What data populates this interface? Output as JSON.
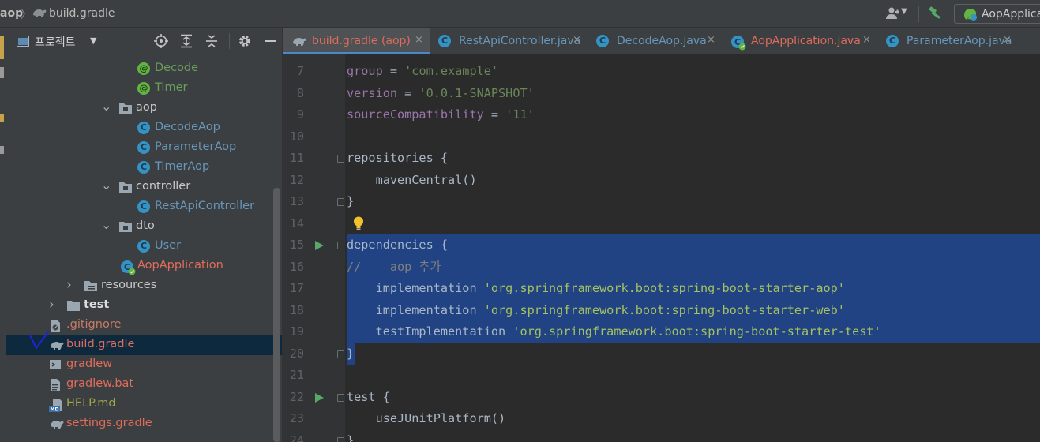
{
  "navbar": {
    "project": "aop",
    "separator": "〉",
    "file": "build.gradle",
    "run_config": "AopApplication"
  },
  "project_panel": {
    "title": "프로젝트",
    "tree": [
      {
        "label": "Decode",
        "icon": "annotation-icon",
        "color": "green",
        "indent": 166
      },
      {
        "label": "Timer",
        "icon": "annotation-icon",
        "color": "green",
        "indent": 166
      },
      {
        "label": "aop",
        "icon": "package-folder-icon",
        "color": "white",
        "indent": 142,
        "arrow": "down"
      },
      {
        "label": "DecodeAop",
        "icon": "class-icon",
        "color": "blue",
        "indent": 166
      },
      {
        "label": "ParameterAop",
        "icon": "class-icon",
        "color": "blue",
        "indent": 166
      },
      {
        "label": "TimerAop",
        "icon": "class-icon",
        "color": "blue",
        "indent": 166
      },
      {
        "label": "controller",
        "icon": "package-folder-icon",
        "color": "white",
        "indent": 142,
        "arrow": "down"
      },
      {
        "label": "RestApiController",
        "icon": "class-icon",
        "color": "blue",
        "indent": 166
      },
      {
        "label": "dto",
        "icon": "package-folder-icon",
        "color": "white",
        "indent": 142,
        "arrow": "down"
      },
      {
        "label": "User",
        "icon": "class-icon",
        "color": "blue",
        "indent": 166
      },
      {
        "label": "AopApplication",
        "icon": "spring-app-icon",
        "color": "red",
        "indent": 144
      },
      {
        "label": "resources",
        "icon": "resources-folder-icon",
        "color": "white",
        "indent": 98,
        "arrow": "right"
      },
      {
        "label": "test",
        "icon": "folder-icon",
        "color": "bold",
        "indent": 76,
        "arrow": "right"
      },
      {
        "label": ".gitignore",
        "icon": "gitignore-icon",
        "color": "gitred",
        "indent": 54
      },
      {
        "label": "build.gradle",
        "icon": "gradle-icon",
        "color": "red",
        "indent": 54,
        "selected": true
      },
      {
        "label": "gradlew",
        "icon": "terminal-file-icon",
        "color": "red",
        "indent": 54
      },
      {
        "label": "gradlew.bat",
        "icon": "text-file-icon",
        "color": "red",
        "indent": 54
      },
      {
        "label": "HELP.md",
        "icon": "markdown-icon",
        "color": "md",
        "indent": 54
      },
      {
        "label": "settings.gradle",
        "icon": "gradle-icon",
        "color": "red",
        "indent": 54
      }
    ]
  },
  "editor": {
    "tabs": [
      {
        "label": "build.gradle (aop)",
        "icon": "gradle-icon",
        "color": "#e06c5c",
        "active": true
      },
      {
        "label": "RestApiController.java",
        "icon": "class-icon",
        "color": "#6897bb"
      },
      {
        "label": "DecodeAop.java",
        "icon": "class-icon",
        "color": "#6897bb"
      },
      {
        "label": "AopApplication.java",
        "icon": "spring-app-icon",
        "color": "#e06c5c"
      },
      {
        "label": "ParameterAop.java",
        "icon": "class-icon",
        "color": "#6897bb"
      }
    ],
    "close_glyph": "×",
    "lines": [
      {
        "num": "7",
        "parts": [
          [
            "id",
            "group"
          ],
          [
            "plain",
            " = "
          ],
          [
            "str",
            "'com.example'"
          ]
        ]
      },
      {
        "num": "8",
        "parts": [
          [
            "id",
            "version"
          ],
          [
            "plain",
            " = "
          ],
          [
            "str",
            "'0.0.1-SNAPSHOT'"
          ]
        ]
      },
      {
        "num": "9",
        "parts": [
          [
            "id",
            "sourceCompatibility"
          ],
          [
            "plain",
            " = "
          ],
          [
            "str",
            "'11'"
          ]
        ]
      },
      {
        "num": "10",
        "parts": []
      },
      {
        "num": "11",
        "parts": [
          [
            "plain",
            "repositories {"
          ]
        ],
        "fold": true
      },
      {
        "num": "12",
        "parts": [
          [
            "plain",
            "    mavenCentral()"
          ]
        ]
      },
      {
        "num": "13",
        "parts": [
          [
            "plain",
            "}"
          ]
        ],
        "fold": true
      },
      {
        "num": "14",
        "parts": [],
        "bulb": true
      },
      {
        "num": "15",
        "parts": [
          [
            "plain",
            "dependencies {"
          ]
        ],
        "fold": true,
        "run": true,
        "sel": 878
      },
      {
        "num": "16",
        "parts": [
          [
            "cmt",
            "//    aop 추가"
          ]
        ],
        "sel": 878
      },
      {
        "num": "17",
        "parts": [
          [
            "plain",
            "    implementation "
          ],
          [
            "str-sel",
            "'org.springframework.boot:spring-boot-starter-aop'"
          ]
        ],
        "sel": 878
      },
      {
        "num": "18",
        "parts": [
          [
            "plain",
            "    implementation "
          ],
          [
            "str-sel",
            "'org.springframework.boot:spring-boot-starter-web'"
          ]
        ],
        "sel": 878
      },
      {
        "num": "19",
        "parts": [
          [
            "plain",
            "    testImplementation "
          ],
          [
            "str-sel",
            "'org.springframework.boot:spring-boot-starter-test'"
          ]
        ],
        "sel": 878
      },
      {
        "num": "20",
        "parts": [
          [
            "plain",
            "}"
          ]
        ],
        "fold": true,
        "sel": 10
      },
      {
        "num": "21",
        "parts": []
      },
      {
        "num": "22",
        "parts": [
          [
            "plain",
            "test {"
          ]
        ],
        "fold": true,
        "run": true
      },
      {
        "num": "23",
        "parts": [
          [
            "plain",
            "    useJUnitPlatform()"
          ]
        ]
      },
      {
        "num": "24",
        "parts": [
          [
            "plain",
            "}"
          ]
        ],
        "fold": true
      }
    ]
  }
}
